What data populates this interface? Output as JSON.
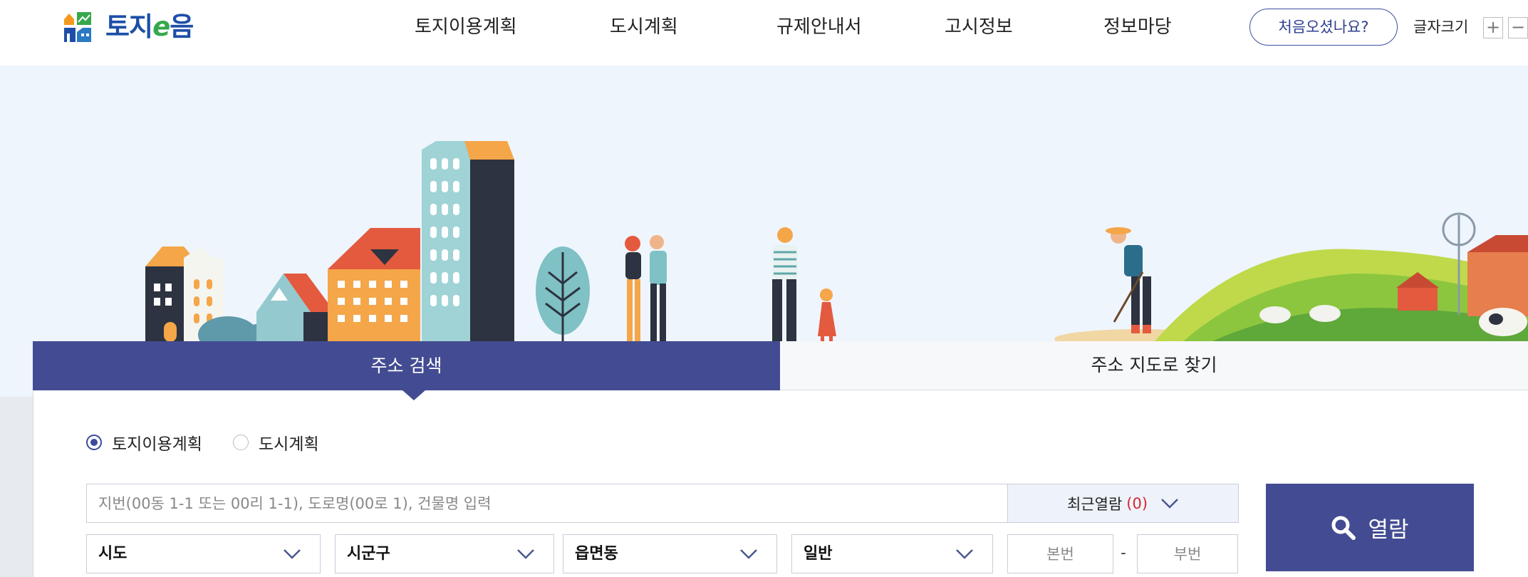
{
  "header": {
    "logo_text_a": "토지",
    "logo_text_e": "e",
    "logo_text_b": "음",
    "nav": [
      "토지이용계획",
      "도시계획",
      "규제안내서",
      "고시정보",
      "정보마당"
    ],
    "first_visit_button": "처음오셨나요?",
    "font_size_label": "글자크기",
    "font_plus": "+",
    "font_minus": "−"
  },
  "tabs": {
    "active": "주소 검색",
    "inactive": "주소 지도로 찾기"
  },
  "radio": {
    "options": [
      "토지이용계획",
      "도시계획"
    ],
    "selected": "토지이용계획"
  },
  "search": {
    "placeholder": "지번(00동 1-1 또는 00리 1-1), 도로명(00로 1), 건물명 입력",
    "recent_label": "최근열람",
    "recent_count": "(0)"
  },
  "selects": {
    "sido": "시도",
    "sigungu": "시군구",
    "eupmyeondong": "읍면동",
    "type": "일반"
  },
  "lot": {
    "main_placeholder": "본번",
    "separator": "-",
    "sub_placeholder": "부번"
  },
  "view_button": "열람",
  "colors": {
    "primary": "#434c92",
    "hero_bg": "#eff5fd",
    "count_red": "#d7262e",
    "logo_blue": "#1d4fa8",
    "logo_green": "#36a84b"
  }
}
